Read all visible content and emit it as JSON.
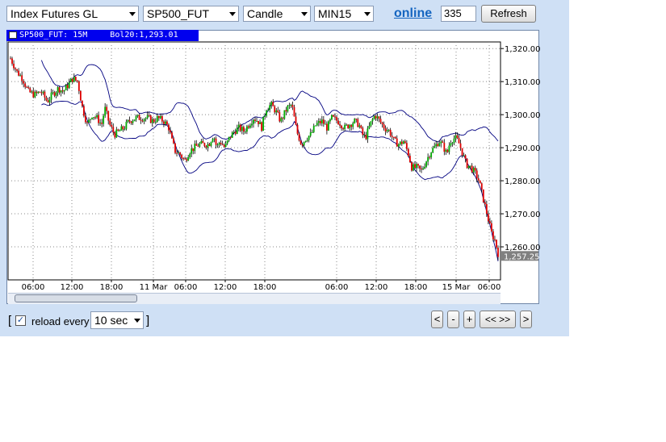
{
  "toolbar": {
    "group_select": "Index Futures GL",
    "symbol_select": "SP500_FUT",
    "chart_type_select": "Candle",
    "interval_select": "MIN15",
    "online_link": "online",
    "bars_input": "335",
    "refresh_label": "Refresh"
  },
  "legend": {
    "symbol_label": "SP500_FUT: 15M",
    "indicator_label": "Bol20:1,293.01"
  },
  "bottom": {
    "bracket_open": "[",
    "reload_label": "reload every",
    "reload_checked": true,
    "reload_interval": "10 sec",
    "bracket_close": "]",
    "nav_prev": "<",
    "nav_zoom_out": "-",
    "nav_zoom_in": "+",
    "nav_fit": "<< >>",
    "nav_next": ">"
  },
  "chart_data": {
    "type": "candlestick",
    "title": "",
    "xlabel": "",
    "ylabel": "",
    "y_ticks": [
      "1,260.00",
      "1,270.00",
      "1,280.00",
      "1,290.00",
      "1,300.00",
      "1,310.00",
      "1,320.00"
    ],
    "y_tick_values": [
      1260,
      1270,
      1280,
      1290,
      1300,
      1310,
      1320
    ],
    "x_ticks": [
      "06:00",
      "12:00",
      "18:00",
      "11 Mar",
      "06:00",
      "12:00",
      "18:00",
      "06:00",
      "12:00",
      "18:00",
      "15 Mar",
      "06:00"
    ],
    "ylim": [
      1250,
      1322
    ],
    "last_price_label": "1,257.25",
    "last_price": 1257.25,
    "bollinger_period": 20,
    "bollinger_mid_last": 1293.01,
    "colors": {
      "up": "#00aa00",
      "down": "#dd0000",
      "wick": "#000000",
      "band": "#000080",
      "last_price_bg": "#808080"
    },
    "price_path": [
      [
        0,
        1317
      ],
      [
        8,
        1313
      ],
      [
        15,
        1311
      ],
      [
        22,
        1307
      ],
      [
        30,
        1306
      ],
      [
        38,
        1307
      ],
      [
        46,
        1304
      ],
      [
        52,
        1306
      ],
      [
        60,
        1308
      ],
      [
        66,
        1307
      ],
      [
        72,
        1309
      ],
      [
        78,
        1311
      ],
      [
        84,
        1310
      ],
      [
        90,
        1302
      ],
      [
        96,
        1297
      ],
      [
        102,
        1300
      ],
      [
        108,
        1299
      ],
      [
        114,
        1297
      ],
      [
        118,
        1302
      ],
      [
        124,
        1297
      ],
      [
        130,
        1294
      ],
      [
        136,
        1295
      ],
      [
        142,
        1296
      ],
      [
        148,
        1298
      ],
      [
        156,
        1299
      ],
      [
        164,
        1299
      ],
      [
        172,
        1299
      ],
      [
        178,
        1298
      ],
      [
        184,
        1299
      ],
      [
        192,
        1298
      ],
      [
        198,
        1296
      ],
      [
        202,
        1292
      ],
      [
        206,
        1289
      ],
      [
        212,
        1288
      ],
      [
        218,
        1286
      ],
      [
        224,
        1289
      ],
      [
        230,
        1290
      ],
      [
        236,
        1291
      ],
      [
        242,
        1291
      ],
      [
        248,
        1291
      ],
      [
        254,
        1294
      ],
      [
        258,
        1290
      ],
      [
        262,
        1292
      ],
      [
        268,
        1290
      ],
      [
        274,
        1293
      ],
      [
        280,
        1295
      ],
      [
        286,
        1296
      ],
      [
        292,
        1295
      ],
      [
        298,
        1297
      ],
      [
        304,
        1299
      ],
      [
        310,
        1298
      ],
      [
        314,
        1296
      ],
      [
        320,
        1302
      ],
      [
        326,
        1303
      ],
      [
        332,
        1301
      ],
      [
        338,
        1298
      ],
      [
        346,
        1302
      ],
      [
        352,
        1303
      ],
      [
        358,
        1295
      ],
      [
        364,
        1291
      ],
      [
        370,
        1293
      ],
      [
        376,
        1294
      ],
      [
        382,
        1297
      ],
      [
        390,
        1298
      ],
      [
        396,
        1296
      ],
      [
        402,
        1299
      ],
      [
        410,
        1298
      ],
      [
        418,
        1296
      ],
      [
        424,
        1297
      ],
      [
        430,
        1298
      ],
      [
        436,
        1297
      ],
      [
        440,
        1294
      ],
      [
        444,
        1293
      ],
      [
        450,
        1297
      ],
      [
        456,
        1300
      ],
      [
        462,
        1298
      ],
      [
        468,
        1296
      ],
      [
        474,
        1295
      ],
      [
        480,
        1292
      ],
      [
        486,
        1291
      ],
      [
        492,
        1292
      ],
      [
        498,
        1288
      ],
      [
        502,
        1284
      ],
      [
        508,
        1284
      ],
      [
        514,
        1283
      ],
      [
        520,
        1286
      ],
      [
        526,
        1289
      ],
      [
        530,
        1290
      ],
      [
        536,
        1292
      ],
      [
        540,
        1291
      ],
      [
        546,
        1288
      ],
      [
        550,
        1292
      ],
      [
        556,
        1293
      ],
      [
        560,
        1292
      ],
      [
        566,
        1288
      ],
      [
        570,
        1285
      ],
      [
        576,
        1284
      ],
      [
        582,
        1282
      ],
      [
        586,
        1280
      ],
      [
        590,
        1276
      ],
      [
        594,
        1272
      ],
      [
        598,
        1268
      ],
      [
        602,
        1264
      ],
      [
        606,
        1262
      ],
      [
        610,
        1258
      ]
    ]
  }
}
